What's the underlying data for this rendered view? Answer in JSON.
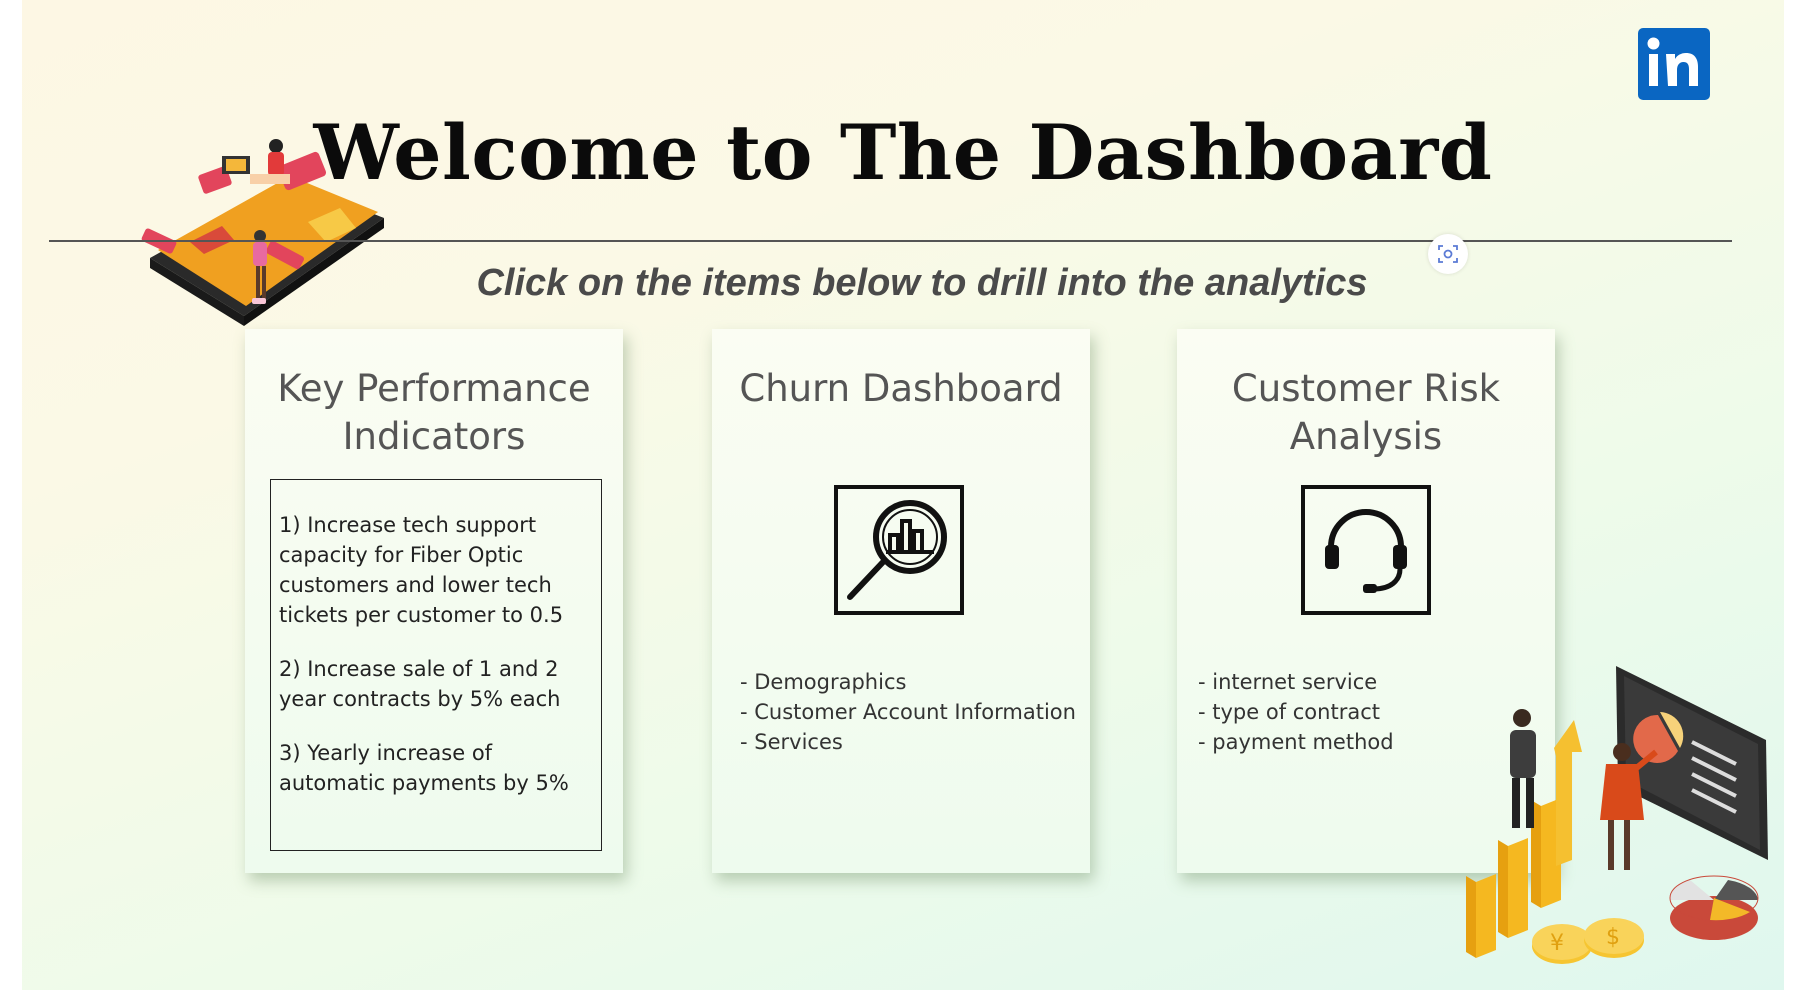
{
  "header": {
    "title": "Welcome to The Dashboard",
    "subtitle": "Click on the items below to drill into the analytics"
  },
  "brand": {
    "logo_text": "in",
    "logo_color": "#0a66c2"
  },
  "cards": [
    {
      "title": "Key Performance Indicators",
      "items": [
        "1) Increase tech support capacity for Fiber Optic customers and lower tech tickets per customer to 0.5",
        "2) Increase sale of 1 and 2 year contracts by 5% each",
        "3) Yearly increase of automatic payments by 5%"
      ]
    },
    {
      "title": "Churn Dashboard",
      "icon": "magnifier-chart-icon",
      "items": [
        "- Demographics",
        "- Customer Account Information",
        "- Services"
      ]
    },
    {
      "title": "Customer Risk Analysis",
      "icon": "headset-icon",
      "items": [
        "- internet service",
        "- type of contract",
        "- payment method"
      ]
    }
  ],
  "colors": {
    "accent_orange": "#f0a020",
    "accent_red": "#d94a3a",
    "gold": "#f5c030"
  }
}
